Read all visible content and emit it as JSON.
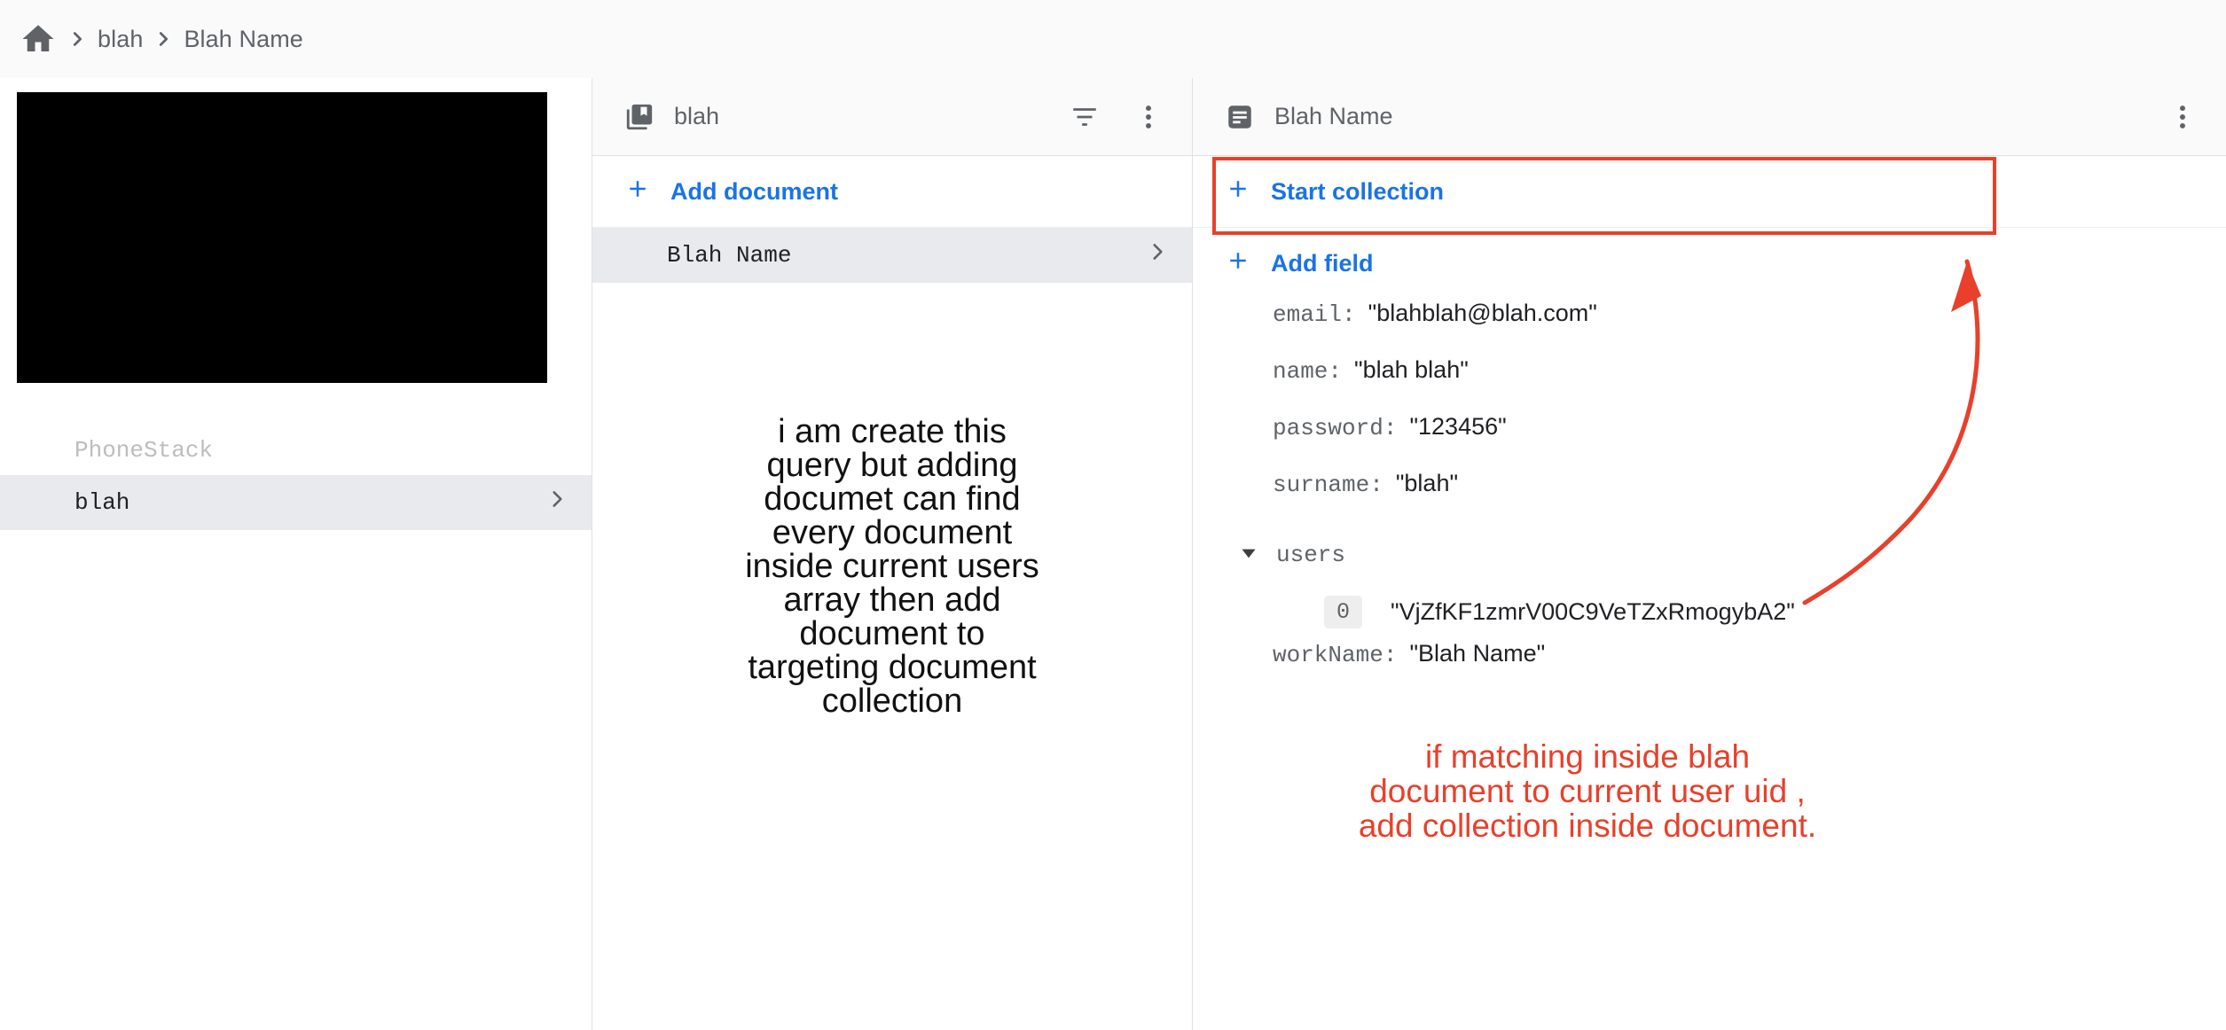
{
  "breadcrumb": {
    "home_icon": "home-icon",
    "separator_icon": "chevron-right-icon",
    "items": [
      {
        "label": "blah"
      },
      {
        "label": "Blah Name"
      }
    ]
  },
  "left_panel": {
    "ghost_item_label": "PhoneStack",
    "selected_item": {
      "label": "blah",
      "chevron_icon": "chevron-right-icon"
    },
    "redaction": "black-redaction-block"
  },
  "middle_panel": {
    "header": {
      "icon": "collections-bookmark-icon",
      "title": "blah",
      "filter_icon": "filter-list-icon",
      "menu_icon": "more-vert-icon"
    },
    "add_document_label": "Add document",
    "documents": [
      {
        "label": "Blah Name",
        "selected": true,
        "chevron_icon": "chevron-right-icon"
      }
    ],
    "annotation": [
      "i am create this",
      "query but adding",
      "documet can find",
      "every document",
      "inside current users",
      "array then add",
      "document to",
      "targeting document",
      "collection"
    ]
  },
  "right_panel": {
    "header": {
      "icon": "document-icon",
      "title": "Blah Name",
      "menu_icon": "more-vert-icon"
    },
    "start_collection_label": "Start collection",
    "add_field_label": "Add field",
    "fields": [
      {
        "key": "email",
        "value": "\"blahblah@blah.com\""
      },
      {
        "key": "name",
        "value": "\"blah blah\""
      },
      {
        "key": "password",
        "value": "\"123456\""
      },
      {
        "key": "surname",
        "value": "\"blah\""
      }
    ],
    "array_field": {
      "name": "users",
      "expanded": true,
      "caret_icon": "caret-down-icon",
      "items": [
        {
          "index": "0",
          "value": "\"VjZfKF1zmrV00C9VeTZxRmogybA2\""
        }
      ]
    },
    "fields_after": [
      {
        "key": "workName",
        "value": "\"Blah Name\""
      }
    ],
    "annotation": [
      "if matching inside blah",
      "document to current user uid ,",
      "add collection inside document."
    ]
  },
  "colors": {
    "accent_blue": "#1a73e8",
    "annotation_red": "#e8402a",
    "selected_row": "#e8eaed",
    "header_bg": "#fafafa",
    "text_gray": "#5f6368",
    "text_dark": "#202124"
  }
}
